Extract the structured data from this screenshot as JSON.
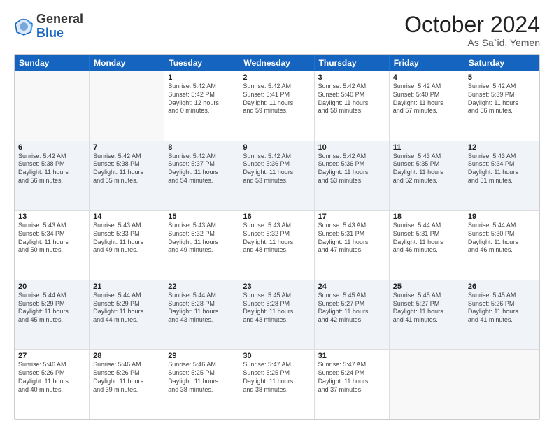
{
  "header": {
    "logo_general": "General",
    "logo_blue": "Blue",
    "month_title": "October 2024",
    "location": "As Sa`id, Yemen"
  },
  "days_of_week": [
    "Sunday",
    "Monday",
    "Tuesday",
    "Wednesday",
    "Thursday",
    "Friday",
    "Saturday"
  ],
  "rows": [
    {
      "alt": false,
      "cells": [
        {
          "day": "",
          "lines": []
        },
        {
          "day": "",
          "lines": []
        },
        {
          "day": "1",
          "lines": [
            "Sunrise: 5:42 AM",
            "Sunset: 5:42 PM",
            "Daylight: 12 hours",
            "and 0 minutes."
          ]
        },
        {
          "day": "2",
          "lines": [
            "Sunrise: 5:42 AM",
            "Sunset: 5:41 PM",
            "Daylight: 11 hours",
            "and 59 minutes."
          ]
        },
        {
          "day": "3",
          "lines": [
            "Sunrise: 5:42 AM",
            "Sunset: 5:40 PM",
            "Daylight: 11 hours",
            "and 58 minutes."
          ]
        },
        {
          "day": "4",
          "lines": [
            "Sunrise: 5:42 AM",
            "Sunset: 5:40 PM",
            "Daylight: 11 hours",
            "and 57 minutes."
          ]
        },
        {
          "day": "5",
          "lines": [
            "Sunrise: 5:42 AM",
            "Sunset: 5:39 PM",
            "Daylight: 11 hours",
            "and 56 minutes."
          ]
        }
      ]
    },
    {
      "alt": true,
      "cells": [
        {
          "day": "6",
          "lines": [
            "Sunrise: 5:42 AM",
            "Sunset: 5:38 PM",
            "Daylight: 11 hours",
            "and 56 minutes."
          ]
        },
        {
          "day": "7",
          "lines": [
            "Sunrise: 5:42 AM",
            "Sunset: 5:38 PM",
            "Daylight: 11 hours",
            "and 55 minutes."
          ]
        },
        {
          "day": "8",
          "lines": [
            "Sunrise: 5:42 AM",
            "Sunset: 5:37 PM",
            "Daylight: 11 hours",
            "and 54 minutes."
          ]
        },
        {
          "day": "9",
          "lines": [
            "Sunrise: 5:42 AM",
            "Sunset: 5:36 PM",
            "Daylight: 11 hours",
            "and 53 minutes."
          ]
        },
        {
          "day": "10",
          "lines": [
            "Sunrise: 5:42 AM",
            "Sunset: 5:36 PM",
            "Daylight: 11 hours",
            "and 53 minutes."
          ]
        },
        {
          "day": "11",
          "lines": [
            "Sunrise: 5:43 AM",
            "Sunset: 5:35 PM",
            "Daylight: 11 hours",
            "and 52 minutes."
          ]
        },
        {
          "day": "12",
          "lines": [
            "Sunrise: 5:43 AM",
            "Sunset: 5:34 PM",
            "Daylight: 11 hours",
            "and 51 minutes."
          ]
        }
      ]
    },
    {
      "alt": false,
      "cells": [
        {
          "day": "13",
          "lines": [
            "Sunrise: 5:43 AM",
            "Sunset: 5:34 PM",
            "Daylight: 11 hours",
            "and 50 minutes."
          ]
        },
        {
          "day": "14",
          "lines": [
            "Sunrise: 5:43 AM",
            "Sunset: 5:33 PM",
            "Daylight: 11 hours",
            "and 49 minutes."
          ]
        },
        {
          "day": "15",
          "lines": [
            "Sunrise: 5:43 AM",
            "Sunset: 5:32 PM",
            "Daylight: 11 hours",
            "and 49 minutes."
          ]
        },
        {
          "day": "16",
          "lines": [
            "Sunrise: 5:43 AM",
            "Sunset: 5:32 PM",
            "Daylight: 11 hours",
            "and 48 minutes."
          ]
        },
        {
          "day": "17",
          "lines": [
            "Sunrise: 5:43 AM",
            "Sunset: 5:31 PM",
            "Daylight: 11 hours",
            "and 47 minutes."
          ]
        },
        {
          "day": "18",
          "lines": [
            "Sunrise: 5:44 AM",
            "Sunset: 5:31 PM",
            "Daylight: 11 hours",
            "and 46 minutes."
          ]
        },
        {
          "day": "19",
          "lines": [
            "Sunrise: 5:44 AM",
            "Sunset: 5:30 PM",
            "Daylight: 11 hours",
            "and 46 minutes."
          ]
        }
      ]
    },
    {
      "alt": true,
      "cells": [
        {
          "day": "20",
          "lines": [
            "Sunrise: 5:44 AM",
            "Sunset: 5:29 PM",
            "Daylight: 11 hours",
            "and 45 minutes."
          ]
        },
        {
          "day": "21",
          "lines": [
            "Sunrise: 5:44 AM",
            "Sunset: 5:29 PM",
            "Daylight: 11 hours",
            "and 44 minutes."
          ]
        },
        {
          "day": "22",
          "lines": [
            "Sunrise: 5:44 AM",
            "Sunset: 5:28 PM",
            "Daylight: 11 hours",
            "and 43 minutes."
          ]
        },
        {
          "day": "23",
          "lines": [
            "Sunrise: 5:45 AM",
            "Sunset: 5:28 PM",
            "Daylight: 11 hours",
            "and 43 minutes."
          ]
        },
        {
          "day": "24",
          "lines": [
            "Sunrise: 5:45 AM",
            "Sunset: 5:27 PM",
            "Daylight: 11 hours",
            "and 42 minutes."
          ]
        },
        {
          "day": "25",
          "lines": [
            "Sunrise: 5:45 AM",
            "Sunset: 5:27 PM",
            "Daylight: 11 hours",
            "and 41 minutes."
          ]
        },
        {
          "day": "26",
          "lines": [
            "Sunrise: 5:45 AM",
            "Sunset: 5:26 PM",
            "Daylight: 11 hours",
            "and 41 minutes."
          ]
        }
      ]
    },
    {
      "alt": false,
      "cells": [
        {
          "day": "27",
          "lines": [
            "Sunrise: 5:46 AM",
            "Sunset: 5:26 PM",
            "Daylight: 11 hours",
            "and 40 minutes."
          ]
        },
        {
          "day": "28",
          "lines": [
            "Sunrise: 5:46 AM",
            "Sunset: 5:26 PM",
            "Daylight: 11 hours",
            "and 39 minutes."
          ]
        },
        {
          "day": "29",
          "lines": [
            "Sunrise: 5:46 AM",
            "Sunset: 5:25 PM",
            "Daylight: 11 hours",
            "and 38 minutes."
          ]
        },
        {
          "day": "30",
          "lines": [
            "Sunrise: 5:47 AM",
            "Sunset: 5:25 PM",
            "Daylight: 11 hours",
            "and 38 minutes."
          ]
        },
        {
          "day": "31",
          "lines": [
            "Sunrise: 5:47 AM",
            "Sunset: 5:24 PM",
            "Daylight: 11 hours",
            "and 37 minutes."
          ]
        },
        {
          "day": "",
          "lines": []
        },
        {
          "day": "",
          "lines": []
        }
      ]
    }
  ]
}
